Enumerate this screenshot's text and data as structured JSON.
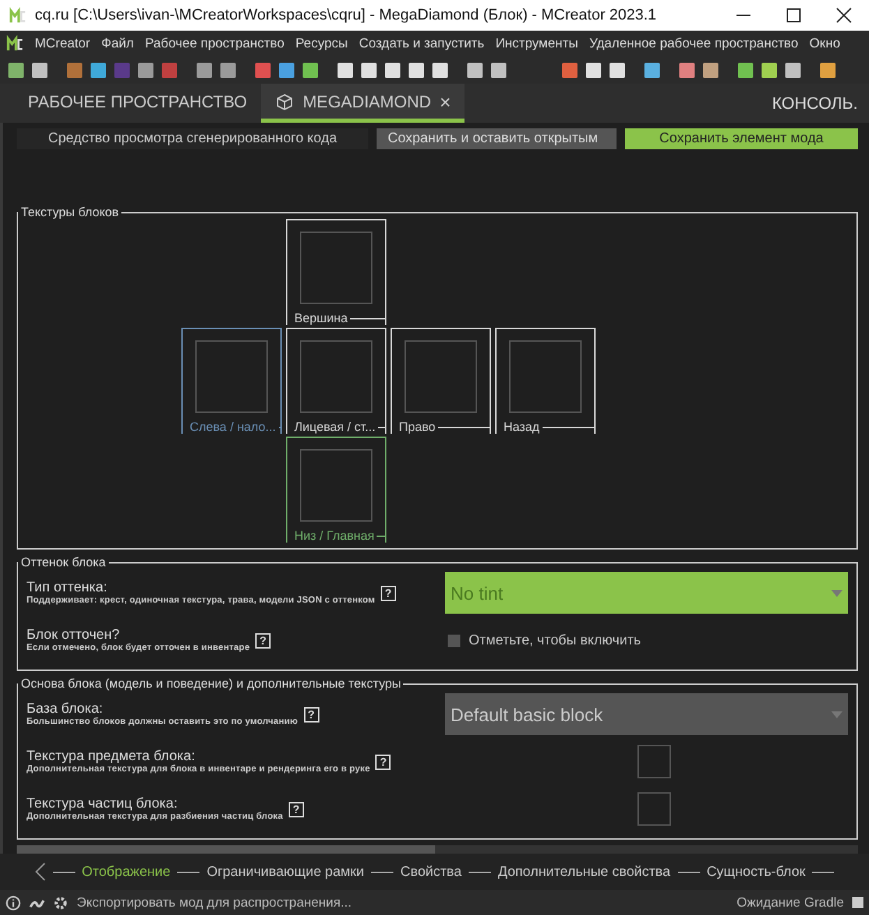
{
  "window": {
    "title": "cq.ru [C:\\Users\\ivan-\\MCreatorWorkspaces\\cqru] - MegaDiamond (Блок) - MCreator 2023.1"
  },
  "menu": [
    "MCreator",
    "Файл",
    "Рабочее пространство",
    "Ресурсы",
    "Создать и запустить",
    "Инструменты",
    "Удаленное рабочее пространство",
    "Окно"
  ],
  "tabs": [
    {
      "label": "РАБОЧЕЕ ПРОСТРАНСТВО",
      "selected": false,
      "closable": false
    },
    {
      "label": "MEGADIAMOND",
      "selected": true,
      "closable": true
    }
  ],
  "close_tab": "×",
  "console": "КОНСОЛЬ.",
  "actions": [
    {
      "label": "Средство просмотра сгенерированного кода",
      "kind": "dark"
    },
    {
      "label": "Сохранить и оставить открытым",
      "kind": "grey"
    },
    {
      "label": "Сохранить элемент мода",
      "kind": "primary"
    }
  ],
  "textures": {
    "title": "Текстуры блоков",
    "slots": [
      {
        "label": "Вершина",
        "color": "#d8d8d8"
      },
      {
        "label": "Слева / нало...",
        "color": "#6a8fb5"
      },
      {
        "label": "Лицевая / ст...",
        "color": "#d8d8d8"
      },
      {
        "label": "Право",
        "color": "#d8d8d8"
      },
      {
        "label": "Назад",
        "color": "#d8d8d8"
      },
      {
        "label": "Низ / Главная",
        "color": "#6fae6a"
      }
    ]
  },
  "tint": {
    "title": "Оттенок блока",
    "rows": [
      {
        "kind": "dropdown",
        "label": "Тип оттенка:",
        "hint": "Поддерживает: крест, одиночная текстура, трава, модели JSON с оттенком",
        "help": "?",
        "value": "No tint",
        "accent": true
      },
      {
        "kind": "checkbox",
        "label": "Блок отточен?",
        "hint": "Если отмечено, блок будет отточен в инвентаре",
        "help": "?",
        "text": "Отметьте, чтобы включить",
        "checked": false
      }
    ]
  },
  "base": {
    "title": "Основа блока (модель и поведение) и дополнительные текстуры",
    "rows": [
      {
        "kind": "dropdown",
        "label": "База блока:",
        "hint": "Большинство блоков должны оставить это по умолчанию",
        "help": "?",
        "value": "Default basic block",
        "accent": false
      },
      {
        "kind": "texture",
        "label": "Текстура предмета блока:",
        "hint": "Дополнительная текстура для блока в инвентаре и рендеринга его в руке",
        "help": "?"
      },
      {
        "kind": "texture",
        "label": "Текстура частиц блока:",
        "hint": "Дополнительная текстура для разбиения частиц блока",
        "help": "?"
      }
    ]
  },
  "pages": [
    {
      "label": "Отображение",
      "selected": true
    },
    {
      "label": "Ограничивающие рамки",
      "selected": false
    },
    {
      "label": "Свойства",
      "selected": false
    },
    {
      "label": "Дополнительные свойства",
      "selected": false
    },
    {
      "label": "Сущность-блок",
      "selected": false
    }
  ],
  "status_bar": {
    "text": "Экспортировать мод для распространения...",
    "right": "Ожидание Gradle"
  }
}
